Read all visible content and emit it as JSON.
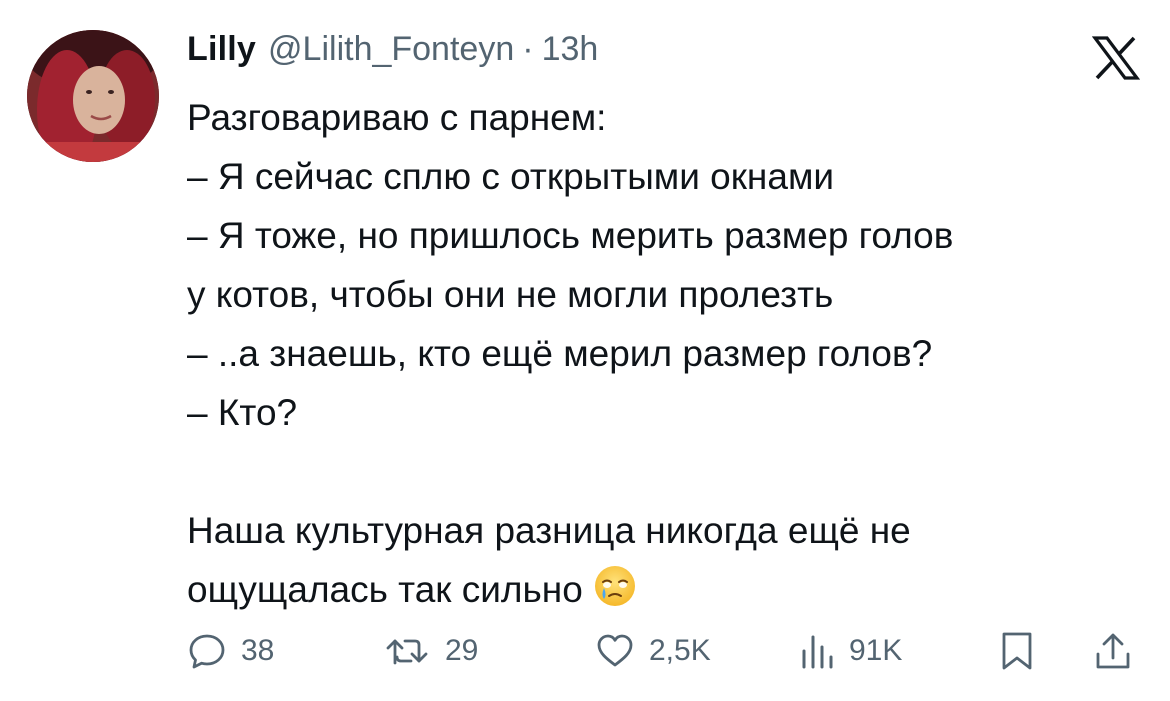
{
  "tweet": {
    "display_name": "Lilly",
    "handle": "@Lilith_Fonteyn",
    "separator": "·",
    "time": "13h",
    "lines": [
      "Разговариваю с парнем:",
      "– Я сейчас сплю с открытыми окнами",
      "– Я тоже, но пришлось мерить размер голов",
      "у котов, чтобы они не могли пролезть",
      "– ..а знаешь, кто ещё мерил размер голов?",
      "– Кто?",
      "",
      "Наша культурная разница никогда ещё не",
      "ощущалась так сильно"
    ],
    "emoji": "face-holding-back-tears"
  },
  "actions": {
    "replies": "38",
    "retweets": "29",
    "likes": "2,5K",
    "views": "91K"
  },
  "icons": {
    "reply": "reply-icon",
    "retweet": "retweet-icon",
    "like": "heart-icon",
    "views": "views-icon",
    "bookmark": "bookmark-icon",
    "share": "share-icon",
    "logo": "x-logo-icon"
  },
  "colors": {
    "text": "#0f1419",
    "secondary": "#536471",
    "background": "#ffffff"
  }
}
